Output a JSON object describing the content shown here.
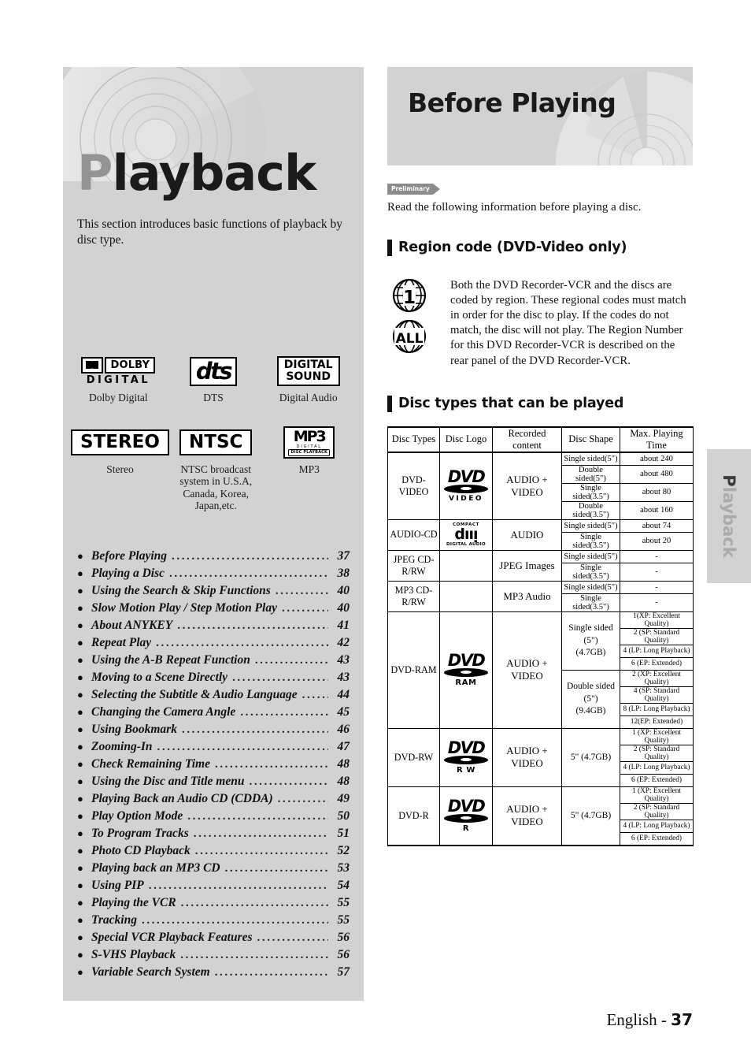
{
  "left": {
    "title_first": "P",
    "title_rest": "layback",
    "intro": "This section introduces basic functions of playback by disc type.",
    "logos": [
      {
        "name": "dolby-digital-logo",
        "caption": "Dolby Digital",
        "word": "DOLBY",
        "sub": "DIGITAL"
      },
      {
        "name": "dts-logo",
        "caption": "DTS",
        "word": "dts"
      },
      {
        "name": "digital-sound-logo",
        "caption": "Digital Audio",
        "line1": "DIGITAL",
        "line2": "SOUND"
      },
      {
        "name": "stereo-logo",
        "caption": "Stereo",
        "word": "STEREO"
      },
      {
        "name": "ntsc-logo",
        "caption": "NTSC broadcast system in U.S.A, Canada, Korea, Japan,etc.",
        "word": "NTSC"
      },
      {
        "name": "mp3-logo",
        "caption": "MP3",
        "top": "MP3",
        "mid": "DIGITAL",
        "bot": "DISC PLAYBACK"
      }
    ],
    "toc": [
      {
        "label": "Before Playing",
        "page": "37"
      },
      {
        "label": "Playing a Disc",
        "page": "38"
      },
      {
        "label": "Using the Search & Skip Functions",
        "page": "40"
      },
      {
        "label": "Slow Motion Play / Step Motion Play",
        "page": "40"
      },
      {
        "label": "About ANYKEY",
        "page": "41"
      },
      {
        "label": "Repeat Play",
        "page": "42"
      },
      {
        "label": "Using the A-B Repeat Function",
        "page": "43"
      },
      {
        "label": "Moving to a Scene Directly",
        "page": "43"
      },
      {
        "label": "Selecting the Subtitle & Audio Language",
        "page": "44"
      },
      {
        "label": "Changing the Camera Angle",
        "page": "45"
      },
      {
        "label": "Using Bookmark",
        "page": "46"
      },
      {
        "label": "Zooming-In",
        "page": "47"
      },
      {
        "label": "Check Remaining Time",
        "page": "48"
      },
      {
        "label": "Using the Disc and Title menu",
        "page": "48"
      },
      {
        "label": "Playing Back an Audio CD (CDDA)",
        "page": "49"
      },
      {
        "label": "Play Option Mode",
        "page": "50"
      },
      {
        "label": "To Program Tracks",
        "page": "51"
      },
      {
        "label": "Photo CD Playback",
        "page": "52"
      },
      {
        "label": "Playing back an MP3 CD",
        "page": "53"
      },
      {
        "label": "Using PIP",
        "page": "54"
      },
      {
        "label": "Playing the VCR",
        "page": "55"
      },
      {
        "label": "Tracking",
        "page": "55"
      },
      {
        "label": "Special VCR Playback Features",
        "page": "56"
      },
      {
        "label": "S-VHS Playback",
        "page": "56"
      },
      {
        "label": "Variable Search System",
        "page": "57"
      }
    ]
  },
  "right": {
    "hero_title": "Before Playing",
    "preliminary_tag": "Preliminary",
    "intro": "Read the following information before playing a disc.",
    "section1_title": "Region code (DVD-Video only)",
    "region_icon_1": "1",
    "region_icon_all": "ALL",
    "region_text": "Both the DVD Recorder-VCR and the discs are coded by region. These regional codes must match in order for the disc to play. If the codes do not match, the disc will not play. The Region Number for this DVD Recorder-VCR is described on the rear panel of the DVD Recorder-VCR.",
    "section2_title": "Disc types that can be played",
    "table": {
      "headers": [
        "Disc Types",
        "Disc Logo",
        "Recorded content",
        "Disc Shape",
        "Max. Playing Time"
      ],
      "rows": [
        {
          "type": "DVD-VIDEO",
          "logo": "dvd-video-logo",
          "logo_sub": "VIDEO",
          "content": "AUDIO + VIDEO",
          "shapes": [
            {
              "shape": "Single sided(5\")",
              "time": "about 240"
            },
            {
              "shape": "Double sided(5\")",
              "time": "about 480"
            },
            {
              "shape": "Single sided(3.5\")",
              "time": "about 80"
            },
            {
              "shape": "Double sided(3.5\")",
              "time": "about 160"
            }
          ]
        },
        {
          "type": "AUDIO-CD",
          "logo": "compact-disc-digital-audio-logo",
          "logo_top": "COMPACT",
          "logo_bot": "DIGITAL AUDIO",
          "content": "AUDIO",
          "shapes": [
            {
              "shape": "Single sided(5\")",
              "time": "about 74"
            },
            {
              "shape": "Single sided(3.5\")",
              "time": "about 20"
            }
          ]
        },
        {
          "type": "JPEG CD-R/RW",
          "logo": "",
          "content": "JPEG Images",
          "shapes": [
            {
              "shape": "Single sided(5\")",
              "time": "-"
            },
            {
              "shape": "Single sided(3.5\")",
              "time": "-"
            }
          ]
        },
        {
          "type": "MP3 CD-R/RW",
          "logo": "",
          "content": "MP3 Audio",
          "shapes": [
            {
              "shape": "Single sided(5\")",
              "time": "-"
            },
            {
              "shape": "Single sided(3.5\")",
              "time": "-"
            }
          ]
        },
        {
          "type": "DVD-RAM",
          "logo": "dvd-ram-logo",
          "logo_sub": "RAM",
          "content": "AUDIO + VIDEO",
          "groups": [
            {
              "shape": "Single sided (5\")<br>(4.7GB)",
              "times": [
                "1(XP: Excellent Quality)",
                "2 (SP: Standard Quality)",
                "4 (LP: Long Playback)",
                "6 (EP: Extended)"
              ]
            },
            {
              "shape": "Double sided (5\")<br>(9.4GB)",
              "times": [
                "2 (XP: Excellent Quality)",
                "4 (SP: Standard Quality)",
                "8 (LP: Long Playback)",
                "12(EP: Extended)"
              ]
            }
          ]
        },
        {
          "type": "DVD-RW",
          "logo": "dvd-rw-logo",
          "logo_sub": "R W",
          "content": "AUDIO + VIDEO",
          "groups": [
            {
              "shape": "5\" (4.7GB)",
              "times": [
                "1 (XP: Excellent Quality)",
                "2 (SP: Standard Quality)",
                "4 (LP: Long Playback)",
                "6 (EP: Extended)"
              ]
            }
          ]
        },
        {
          "type": "DVD-R",
          "logo": "dvd-r-logo",
          "logo_sub": "R",
          "content": "AUDIO + VIDEO",
          "groups": [
            {
              "shape": "5\" (4.7GB)",
              "times": [
                "1 (XP: Excellent Quality)",
                "2 (SP: Standard Quality)",
                "4 (LP: Long Playback)",
                "6 (EP: Extended)"
              ]
            }
          ]
        }
      ]
    }
  },
  "side_tab": {
    "first": "P",
    "rest": "layback"
  },
  "footer": {
    "lang": "English - ",
    "page": "37"
  },
  "colors": {
    "panel_gray": "#d2d2d2",
    "text_dark": "#111111",
    "title_gray": "#949494",
    "tag_gray": "#8c8c8c"
  }
}
